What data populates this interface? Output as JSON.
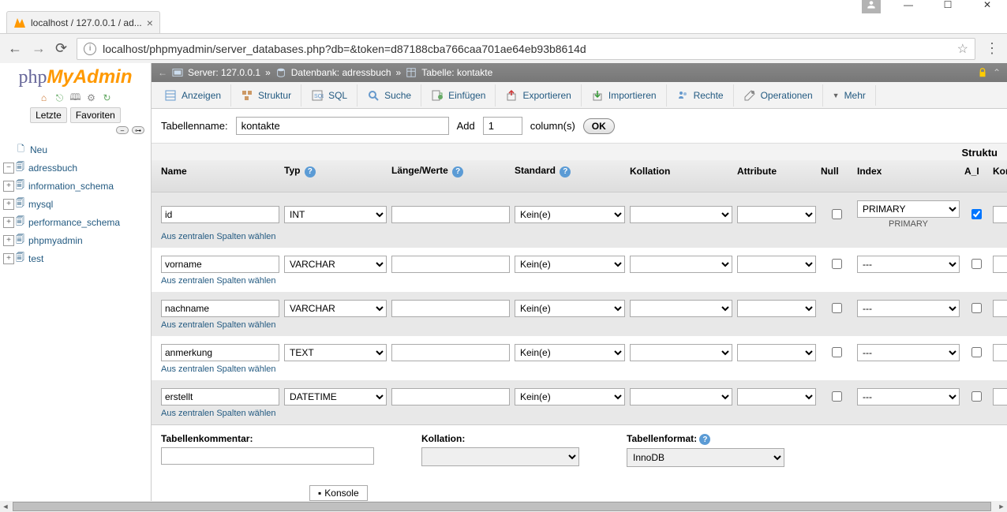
{
  "browser": {
    "tab_title": "localhost / 127.0.0.1 / ad...",
    "url": "localhost/phpmyadmin/server_databases.php?db=&token=d87188cba766caa701ae64eb93b8614d"
  },
  "logo": {
    "php": "php",
    "my": "My",
    "admin": "Admin"
  },
  "sidebar_tabs": {
    "recent": "Letzte",
    "favorites": "Favoriten"
  },
  "tree": {
    "new": "Neu",
    "items": [
      "adressbuch",
      "information_schema",
      "mysql",
      "performance_schema",
      "phpmyadmin",
      "test"
    ]
  },
  "breadcrumb": {
    "server_label": "Server:",
    "server": "127.0.0.1",
    "db_label": "Datenbank:",
    "db": "adressbuch",
    "table_label": "Tabelle:",
    "table": "kontakte"
  },
  "tabs": {
    "browse": "Anzeigen",
    "structure": "Struktur",
    "sql": "SQL",
    "search": "Suche",
    "insert": "Einfügen",
    "export": "Exportieren",
    "import": "Importieren",
    "privileges": "Rechte",
    "operations": "Operationen",
    "more": "Mehr"
  },
  "form": {
    "tablename_label": "Tabellenname:",
    "tablename_value": "kontakte",
    "add_label": "Add",
    "add_value": "1",
    "columns_label": "column(s)",
    "ok": "OK"
  },
  "struct_label": "Struktu",
  "headers": {
    "name": "Name",
    "type": "Typ",
    "length": "Länge/Werte",
    "default": "Standard",
    "collation": "Kollation",
    "attributes": "Attribute",
    "null": "Null",
    "index": "Index",
    "ai": "A_I",
    "comment": "Komm"
  },
  "central_link": "Aus zentralen Spalten wählen",
  "index_primary_sub": "PRIMARY",
  "rows": [
    {
      "name": "id",
      "type": "INT",
      "length": "",
      "default": "Kein(e)",
      "collation": "",
      "attributes": "",
      "null": false,
      "index": "PRIMARY",
      "ai": true
    },
    {
      "name": "vorname",
      "type": "VARCHAR",
      "length": "",
      "default": "Kein(e)",
      "collation": "",
      "attributes": "",
      "null": false,
      "index": "---",
      "ai": false
    },
    {
      "name": "nachname",
      "type": "VARCHAR",
      "length": "",
      "default": "Kein(e)",
      "collation": "",
      "attributes": "",
      "null": false,
      "index": "---",
      "ai": false
    },
    {
      "name": "anmerkung",
      "type": "TEXT",
      "length": "",
      "default": "Kein(e)",
      "collation": "",
      "attributes": "",
      "null": false,
      "index": "---",
      "ai": false
    },
    {
      "name": "erstellt",
      "type": "DATETIME",
      "length": "",
      "default": "Kein(e)",
      "collation": "",
      "attributes": "",
      "null": false,
      "index": "---",
      "ai": false
    }
  ],
  "bottom": {
    "comment_label": "Tabellenkommentar:",
    "collation_label": "Kollation:",
    "storage_label": "Tabellenformat:",
    "storage_value": "InnoDB"
  },
  "konsole": "Konsole"
}
